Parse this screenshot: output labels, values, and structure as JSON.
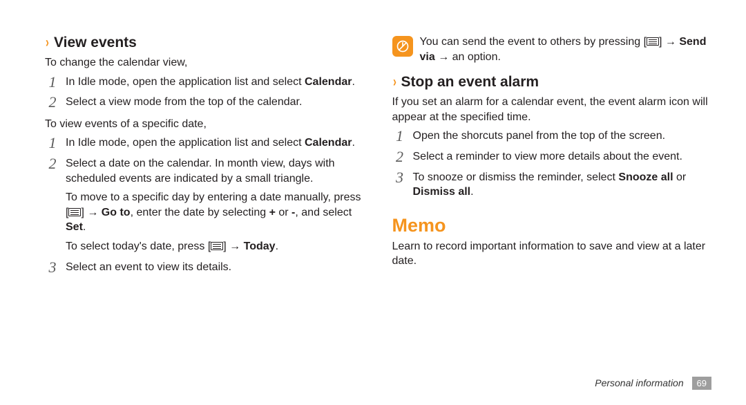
{
  "left": {
    "heading1": "View events",
    "intro1": "To change the calendar view,",
    "list1": [
      {
        "pre": "In Idle mode, open the application list and select ",
        "bold": "Calendar",
        "post": "."
      },
      {
        "pre": "Select a view mode from the top of the calendar.",
        "bold": "",
        "post": ""
      }
    ],
    "intro2": "To view events of a specific date,",
    "list2": [
      {
        "pre": "In Idle mode, open the application list and select ",
        "bold": "Calendar",
        "post": "."
      },
      {
        "pre": "Select a date on the calendar. In month view, days with scheduled events are indicated by a small triangle.",
        "bold": "",
        "post": ""
      }
    ],
    "sub1_pre": "To move to a specific day by entering a date manually, press [",
    "sub1_mid1": "] → ",
    "sub1_bold1": "Go to",
    "sub1_mid2": ", enter the date by selecting ",
    "sub1_bold2": "+",
    "sub1_mid3": " or ",
    "sub1_bold3": "-",
    "sub1_mid4": ", and select ",
    "sub1_bold4": "Set",
    "sub1_post": ".",
    "sub2_pre": "To select today's date, press [",
    "sub2_mid": "] → ",
    "sub2_bold": "Today",
    "sub2_post": ".",
    "list3": [
      {
        "pre": "Select an event to view its details.",
        "bold": "",
        "post": ""
      }
    ]
  },
  "right": {
    "note_pre": "You can send the event to others by pressing [",
    "note_mid": "] → ",
    "note_bold": "Send via",
    "note_post": " → an option.",
    "heading2": "Stop an event alarm",
    "intro3": "If you set an alarm for a calendar event, the event alarm icon will appear at the specified time.",
    "list4": [
      {
        "pre": "Open the shorcuts panel from the top of the screen.",
        "bold": "",
        "post": ""
      },
      {
        "pre": "Select a reminder to view more details about the event.",
        "bold": "",
        "post": ""
      },
      {
        "pre": "To snooze or dismiss the reminder, select ",
        "bold": "Snooze all",
        "mid": " or ",
        "bold2": "Dismiss all",
        "post": "."
      }
    ],
    "h1": "Memo",
    "lead": "Learn to record important information to save and view at a later date."
  },
  "footer": {
    "label": "Personal information",
    "page": "69"
  }
}
